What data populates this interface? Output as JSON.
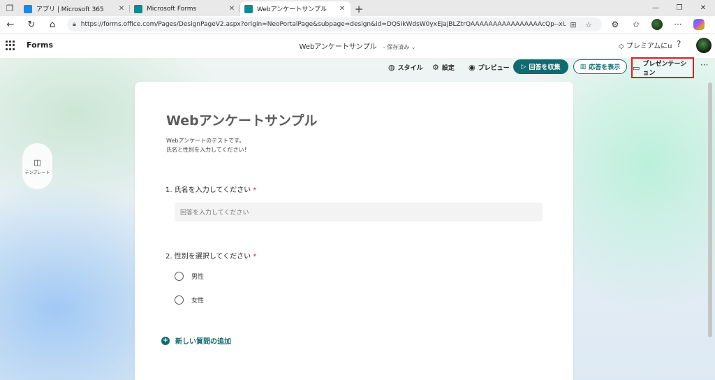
{
  "browser": {
    "tabs": [
      {
        "label": "アプリ | Microsoft 365",
        "color": "#1e88e5"
      },
      {
        "label": "Microsoft Forms",
        "color": "#0f8a8f"
      },
      {
        "label": "Webアンケートサンプル",
        "color": "#0f8a8f"
      }
    ],
    "active_tab": 2,
    "url": "https://forms.office.com/Pages/DesignPageV2.aspx?origin=NeoPortalPage&subpage=design&id=DQSIkWdsW0yxEjajBLZtrQAAAAAAAAAAAAAAAAcQp--xUNEZB...",
    "icons": {
      "back": "back-arrow-icon",
      "refresh": "refresh-icon",
      "home": "home-icon"
    }
  },
  "app": {
    "name": "Forms",
    "doc_title": "Webアンケートサンプル",
    "save_status": "保存済み",
    "premium_label": "プレミアムにu",
    "help_label": "?"
  },
  "toolbar": {
    "style_label": "スタイル",
    "settings_label": "設定",
    "preview_label": "プレビュー",
    "collect_label": "回答を収集",
    "responses_label": "応答を表示",
    "present_label": "プレゼンテーション",
    "more_label": "···"
  },
  "sidebar": {
    "template_label": "テンプレート"
  },
  "form": {
    "title": "Webアンケートサンプル",
    "description_line1": "Webアンケートのテストです。",
    "description_line2": "氏名と性別を入力してください！",
    "questions": [
      {
        "number": "1.",
        "text": "氏名を入力してください",
        "required_mark": "*",
        "placeholder": "回答を入力してください"
      },
      {
        "number": "2.",
        "text": "性別を選択してください",
        "required_mark": "*",
        "options": [
          "男性",
          "女性"
        ]
      }
    ],
    "add_question_label": "新しい質問の追加"
  },
  "colors": {
    "accent": "#0f6b6f",
    "highlight_border": "#e01b24"
  }
}
